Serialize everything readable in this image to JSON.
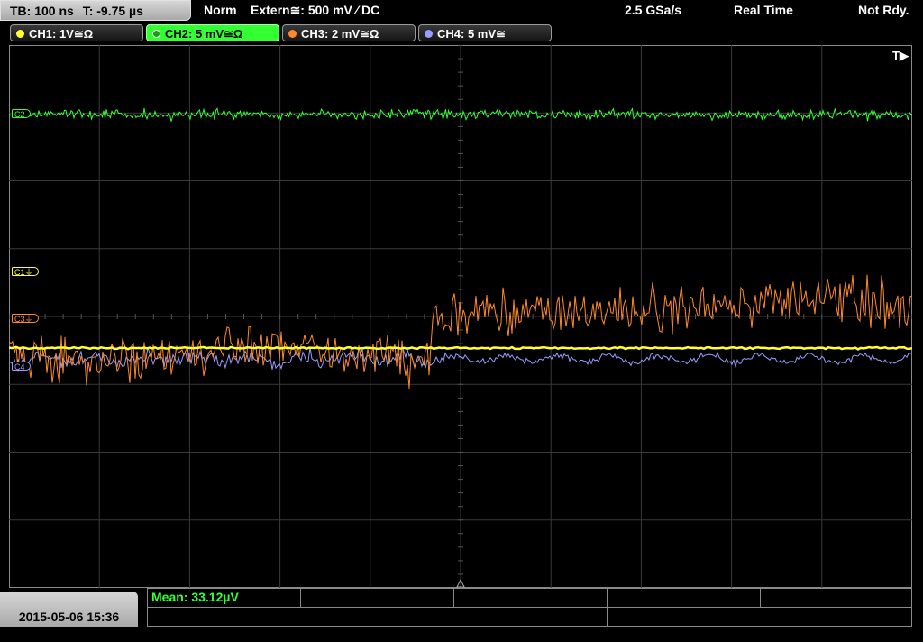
{
  "timebase": {
    "tb": "TB: 100 ns",
    "trigger_offset": "T: -9.75 µs"
  },
  "trigger": {
    "mode": "Norm",
    "source": "Extern≅: 500 mV ⁄ DC",
    "sample_rate": "2.5 GSa/s",
    "acq_mode": "Real Time",
    "status": "Not Rdy."
  },
  "channels": [
    {
      "label": "CH1: 1V≅Ω",
      "color": "#ffff33"
    },
    {
      "label": "CH2: 5 mV≅Ω",
      "color": "#33ff33"
    },
    {
      "label": "CH3: 2 mV≅Ω",
      "color": "#ff8a2a"
    },
    {
      "label": "CH4: 5 mV≅",
      "color": "#9a9cff"
    }
  ],
  "markers": {
    "c1": "C1⏚",
    "c2": "C2",
    "c3": "C3⏚",
    "c4": "C4"
  },
  "trigger_position_mark": "T▶",
  "measurement": {
    "mean": "Mean: 33.12µV"
  },
  "datetime": "2015-05-06 15:36"
}
